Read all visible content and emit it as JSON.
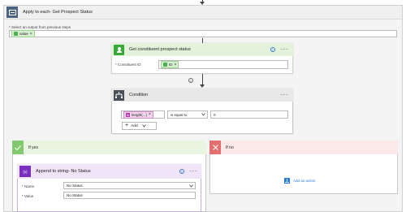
{
  "apply_each": {
    "title": "Apply to each- Get Prospect Status",
    "select_label": "* Select an output from previous steps",
    "token": "value",
    "token_remove": "×",
    "header_color": "#5a6e8c"
  },
  "constituent": {
    "title": "Get constituent prospect status",
    "field_label": "* Constituent ID",
    "token": "ID",
    "token_remove": "×",
    "help": "?",
    "menu": "···"
  },
  "condition": {
    "title": "Condition",
    "left_token": "length(...)",
    "left_remove": "×",
    "operator": "is equal to",
    "value": "0",
    "add_label": "Add",
    "menu": "···",
    "info": "i"
  },
  "if_yes": {
    "title": "If yes",
    "action_title": "Append to string- No Status",
    "help": "?",
    "menu": "···",
    "name_label": "* Name",
    "name_value": "No Status",
    "value_label": "* Value",
    "value_value": "No Status"
  },
  "if_no": {
    "title": "If no",
    "add_action": "Add an action"
  },
  "icons": [
    "loop-icon",
    "constituent-icon",
    "condition-icon",
    "check-icon",
    "x-icon",
    "variable-icon",
    "add-action-icon"
  ]
}
